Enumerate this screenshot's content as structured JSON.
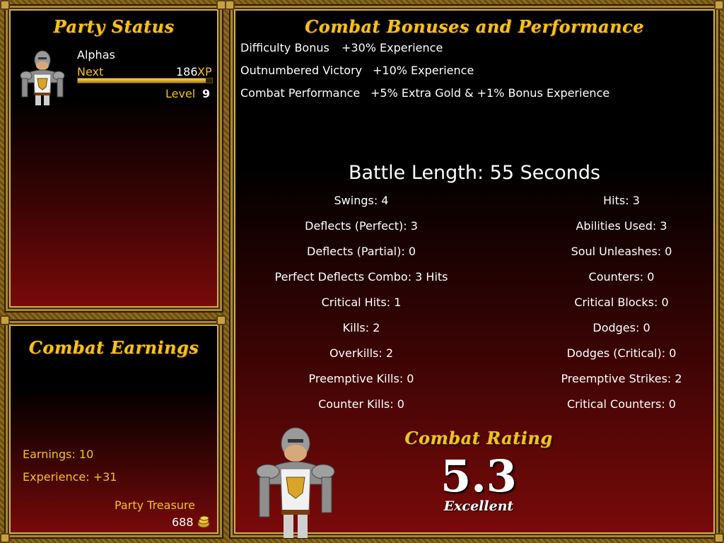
{
  "party_status": {
    "title": "Party Status",
    "member": {
      "name": "Alphas",
      "next_label": "Next",
      "xp_value": "186",
      "xp_unit": "XP",
      "xp_progress": 0.95,
      "level_label": "Level",
      "level_value": "9"
    }
  },
  "combat_earnings": {
    "title": "Combat Earnings",
    "earnings": "Earnings: 10",
    "experience": "Experience: +31",
    "party_treasure_label": "Party Treasure",
    "party_treasure_value": "688"
  },
  "bonuses": {
    "title": "Combat Bonuses and Performance",
    "rows": [
      {
        "label": "Difficulty Bonus",
        "value": "+30% Experience"
      },
      {
        "label": "Outnumbered Victory",
        "value": "+10% Experience"
      },
      {
        "label": "Combat Performance",
        "value": "+5% Extra Gold & +1% Bonus Experience"
      }
    ]
  },
  "battle": {
    "length": "Battle Length:  55 Seconds",
    "left_stats": [
      "Swings: 4",
      "Deflects (Perfect): 3",
      "Deflects (Partial): 0",
      "Perfect Deflects Combo: 3 Hits",
      "Critical Hits: 1",
      "Kills: 2",
      "Overkills: 2",
      "Preemptive Kills: 0",
      "Counter Kills: 0"
    ],
    "right_stats": [
      "Hits: 3",
      "Abilities Used: 3",
      "Soul Unleashes: 0",
      "Counters: 0",
      "Critical Blocks: 0",
      "Dodges: 0",
      "Dodges (Critical): 0",
      "Preemptive Strikes: 2",
      "Critical Counters: 0"
    ]
  },
  "rating": {
    "title": "Combat Rating",
    "value": "5.3",
    "label": "Excellent"
  },
  "icons": {
    "portrait": "knight-portrait-icon",
    "treasure": "gold-coin-bag-icon",
    "knight_figure": "knight-figure-icon"
  },
  "colors": {
    "accent_gold": "#f5c21a",
    "frame_gold": "#a8862c",
    "panel_red": "#7a0a0a"
  }
}
